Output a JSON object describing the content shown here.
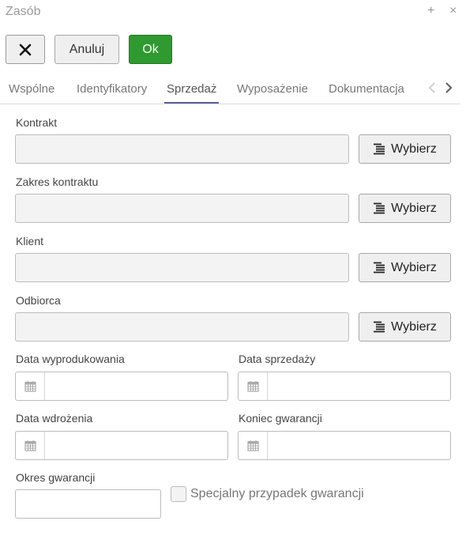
{
  "window": {
    "title": "Zasób",
    "plus_glyph": "+",
    "close_glyph": "×"
  },
  "toolbar": {
    "close_icon": "x-icon",
    "cancel_label": "Anuluj",
    "ok_label": "Ok",
    "ok_color": "#2f9a2f"
  },
  "tabs": {
    "items": [
      {
        "label": "Wspólne"
      },
      {
        "label": "Identyfikatory"
      },
      {
        "label": "Sprzedaż"
      },
      {
        "label": "Wyposażenie"
      },
      {
        "label": "Dokumentacja"
      }
    ],
    "active": "Sprzedaż",
    "accent_color": "#5a5f9c",
    "prev_icon": "chevron-left-icon",
    "next_icon": "chevron-right-icon"
  },
  "form": {
    "pick_label": "Wybierz",
    "pick_icon": "list-icon",
    "kontrakt": {
      "label": "Kontrakt",
      "value": ""
    },
    "zakres_kontraktu": {
      "label": "Zakres kontraktu",
      "value": ""
    },
    "klient": {
      "label": "Klient",
      "value": ""
    },
    "odbiorca": {
      "label": "Odbiorca",
      "value": ""
    },
    "data_wyprodukowania": {
      "label": "Data wyprodukowania",
      "value": ""
    },
    "data_sprzedazy": {
      "label": "Data sprzedaży",
      "value": ""
    },
    "data_wdrozenia": {
      "label": "Data wdrożenia",
      "value": ""
    },
    "koniec_gwarancji": {
      "label": "Koniec gwarancji",
      "value": ""
    },
    "okres_gwarancji": {
      "label": "Okres gwarancji",
      "value": ""
    },
    "specjalny_przypadek": {
      "label": "Specjalny przypadek gwarancji",
      "checked": false
    },
    "calendar_icon": "calendar-icon"
  }
}
